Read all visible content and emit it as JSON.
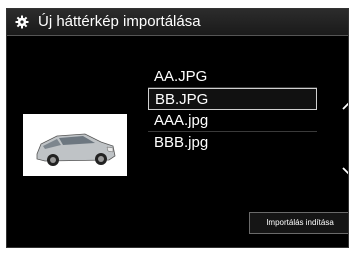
{
  "header": {
    "icon": "gear-icon",
    "title": "Új háttérkép importálása"
  },
  "files": [
    {
      "name": "AA.JPG",
      "selected": false
    },
    {
      "name": "BB.JPG",
      "selected": true
    },
    {
      "name": "AAA.jpg",
      "selected": false
    },
    {
      "name": "BBB.jpg",
      "selected": false
    }
  ],
  "scroll": {
    "up_icon": "chevron-up-icon",
    "down_icon": "chevron-down-icon"
  },
  "preview": {
    "image": "car-thumbnail"
  },
  "actions": {
    "start_import_label": "Importálás indítása"
  }
}
